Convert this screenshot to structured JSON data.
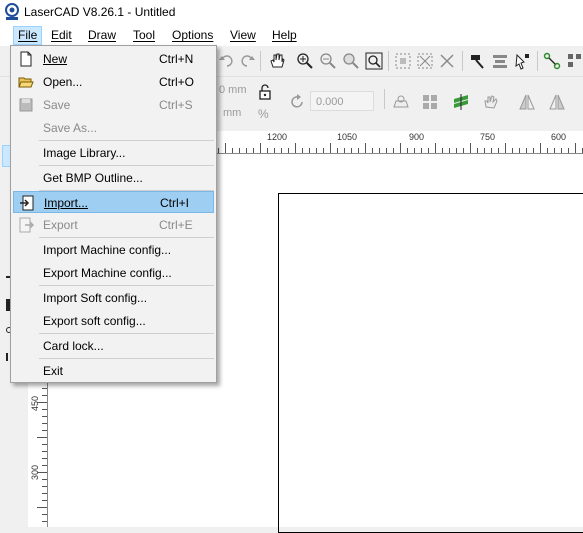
{
  "window": {
    "title": "LaserCAD V8.26.1 - Untitled"
  },
  "menubar": [
    {
      "label": "File",
      "active": true
    },
    {
      "label": "Edit"
    },
    {
      "label": "Draw"
    },
    {
      "label": "Tool"
    },
    {
      "label": "Options"
    },
    {
      "label": "View"
    },
    {
      "label": "Help"
    }
  ],
  "file_menu": {
    "items": [
      {
        "label": "New",
        "shortcut": "Ctrl+N",
        "icon": "new-file-icon",
        "enabled": true
      },
      {
        "label": "Open...",
        "shortcut": "Ctrl+O",
        "icon": "open-folder-icon",
        "enabled": true
      },
      {
        "label": "Save",
        "shortcut": "Ctrl+S",
        "icon": "save-disk-icon",
        "enabled": false
      },
      {
        "label": "Save As...",
        "shortcut": "",
        "enabled": false
      },
      {
        "label": "Image Library...",
        "shortcut": "",
        "enabled": true
      },
      {
        "label": "Get BMP Outline...",
        "shortcut": "",
        "enabled": true
      },
      {
        "label": "Import...",
        "shortcut": "Ctrl+I",
        "icon": "import-icon",
        "enabled": true,
        "highlighted": true
      },
      {
        "label": "Export",
        "shortcut": "Ctrl+E",
        "icon": "export-icon",
        "enabled": false
      },
      {
        "label": "Import Machine config...",
        "shortcut": "",
        "enabled": true
      },
      {
        "label": "Export Machine config...",
        "shortcut": "",
        "enabled": true
      },
      {
        "label": "Import Soft config...",
        "shortcut": "",
        "enabled": true
      },
      {
        "label": "Export soft config...",
        "shortcut": "",
        "enabled": true
      },
      {
        "label": "Card lock...",
        "shortcut": "",
        "enabled": true
      },
      {
        "label": "Exit",
        "shortcut": "",
        "enabled": true
      }
    ]
  },
  "toolbar": {
    "size_unit_1": "0 mm",
    "size_unit_2": "mm",
    "percent": "%",
    "rotate_angle": "0.000"
  },
  "ruler": {
    "top_labels": [
      "1200",
      "1050",
      "900",
      "750",
      "600"
    ],
    "left_labels": [
      "450",
      "300"
    ]
  }
}
